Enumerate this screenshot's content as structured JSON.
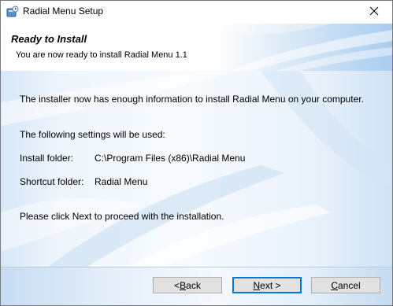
{
  "window": {
    "title": "Radial Menu Setup",
    "icon": "installer-icon",
    "close_icon": "close-icon"
  },
  "header": {
    "title": "Ready to Install",
    "subtitle": "You are now ready to install Radial Menu 1.1"
  },
  "body": {
    "intro": "The installer now has enough information to install Radial Menu on your computer.",
    "settings_heading": "The following settings will be used:",
    "install_folder_label": "Install folder:",
    "install_folder_value": "C:\\Program Files (x86)\\Radial Menu",
    "shortcut_folder_label": "Shortcut folder:",
    "shortcut_folder_value": "Radial Menu",
    "proceed_text": "Please click Next to proceed with the installation."
  },
  "buttons": {
    "back_prefix": "< ",
    "back_accel": "B",
    "back_rest": "ack",
    "next_accel": "N",
    "next_rest": "ext >",
    "cancel_accel": "C",
    "cancel_rest": "ancel"
  }
}
